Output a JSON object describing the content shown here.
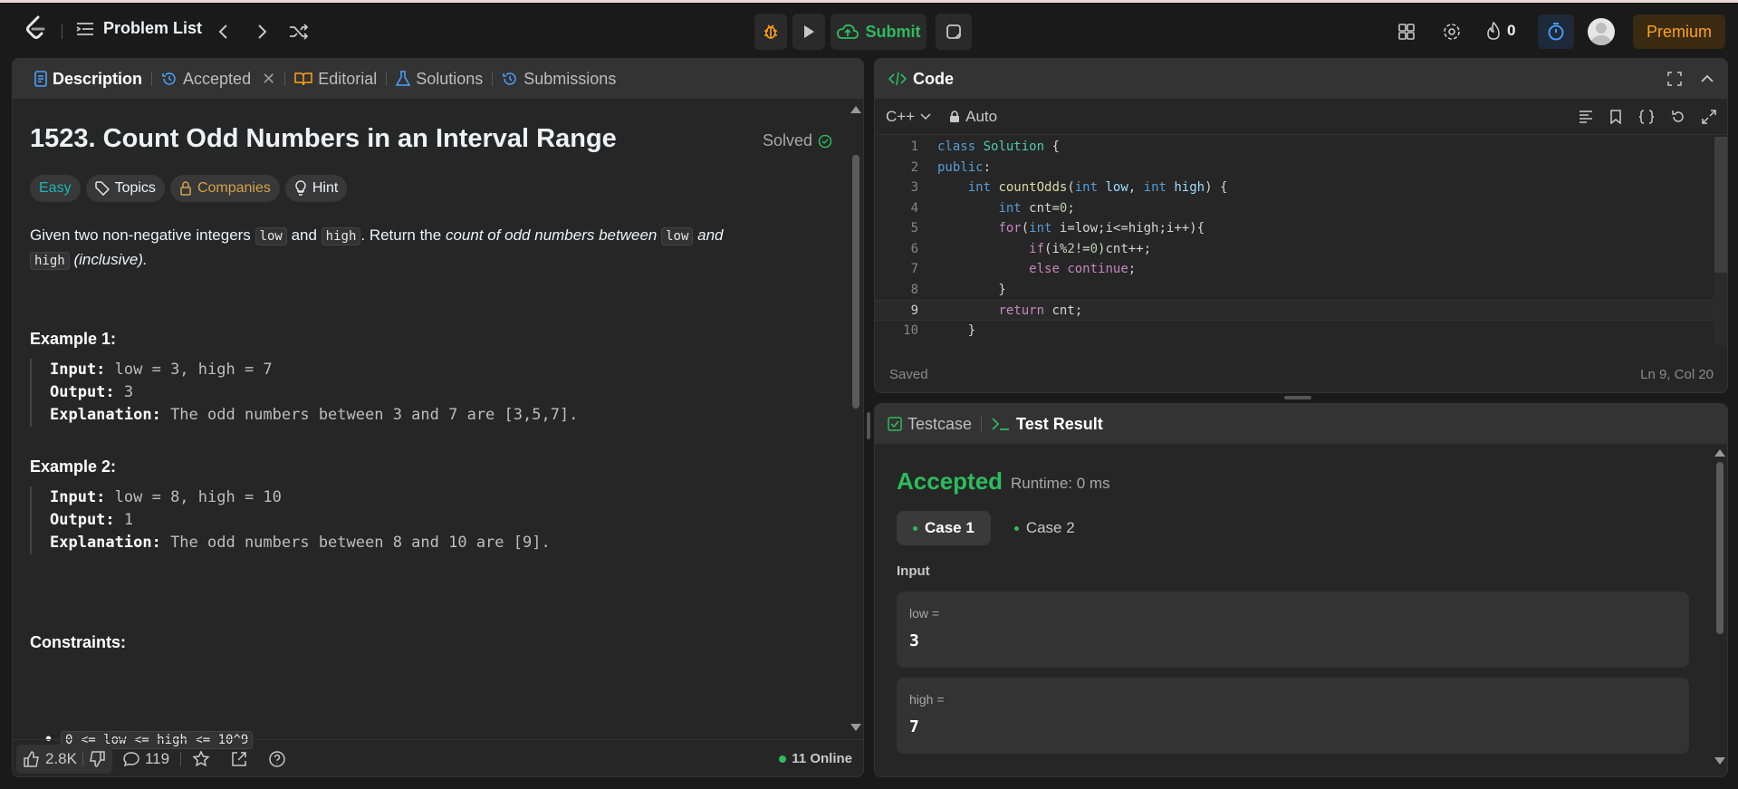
{
  "topbar": {
    "problem_list": "Problem List",
    "submit": "Submit",
    "streak": "0",
    "premium": "Premium"
  },
  "left_tabs": [
    {
      "label": "Description"
    },
    {
      "label": "Accepted"
    },
    {
      "label": "Editorial"
    },
    {
      "label": "Solutions"
    },
    {
      "label": "Submissions"
    }
  ],
  "problem": {
    "title": "1523. Count Odd Numbers in an Interval Range",
    "solved": "Solved",
    "difficulty": "Easy",
    "topics": "Topics",
    "companies": "Companies",
    "hint": "Hint",
    "desc_1": "Given two non-negative integers ",
    "code_low": "low",
    "desc_2": " and ",
    "code_high": "high",
    "desc_3": ". Return the ",
    "desc_4": "count of odd numbers between ",
    "desc_5": " and",
    "desc_6": " (inclusive).",
    "example1_title": "Example 1:",
    "example1": {
      "input_label": "Input:",
      "input": " low = 3, high = 7",
      "output_label": "Output:",
      "output": " 3",
      "expl_label": "Explanation:",
      "expl": " The odd numbers between 3 and 7 are [3,5,7]."
    },
    "example2_title": "Example 2:",
    "example2": {
      "input_label": "Input:",
      "input": " low = 8, high = 10",
      "output_label": "Output:",
      "output": " 1",
      "expl_label": "Explanation:",
      "expl": " The odd numbers between 8 and 10 are [9]."
    },
    "constraints_title": "Constraints:",
    "constraint": "0 <= low <= high <= 10^9"
  },
  "footer": {
    "likes": "2.8K",
    "comments": "119",
    "online": "11 Online"
  },
  "code_panel": {
    "title": "Code",
    "language": "C++",
    "mode": "Auto",
    "saved": "Saved",
    "cursor": "Ln 9, Col 20",
    "line_numbers": [
      "1",
      "2",
      "3",
      "4",
      "5",
      "6",
      "7",
      "8",
      "9",
      "10"
    ]
  },
  "test_panel": {
    "tab_testcase": "Testcase",
    "tab_result": "Test Result",
    "status": "Accepted",
    "runtime": "Runtime: 0 ms",
    "case1": "Case 1",
    "case2": "Case 2",
    "input_label": "Input",
    "var1_name": "low =",
    "var1_value": "3",
    "var2_name": "high =",
    "var2_value": "7"
  },
  "colors": {
    "accent_green": "#2cbb5d",
    "premium_orange": "#ffa116",
    "easy_teal": "#1cb8b8"
  }
}
